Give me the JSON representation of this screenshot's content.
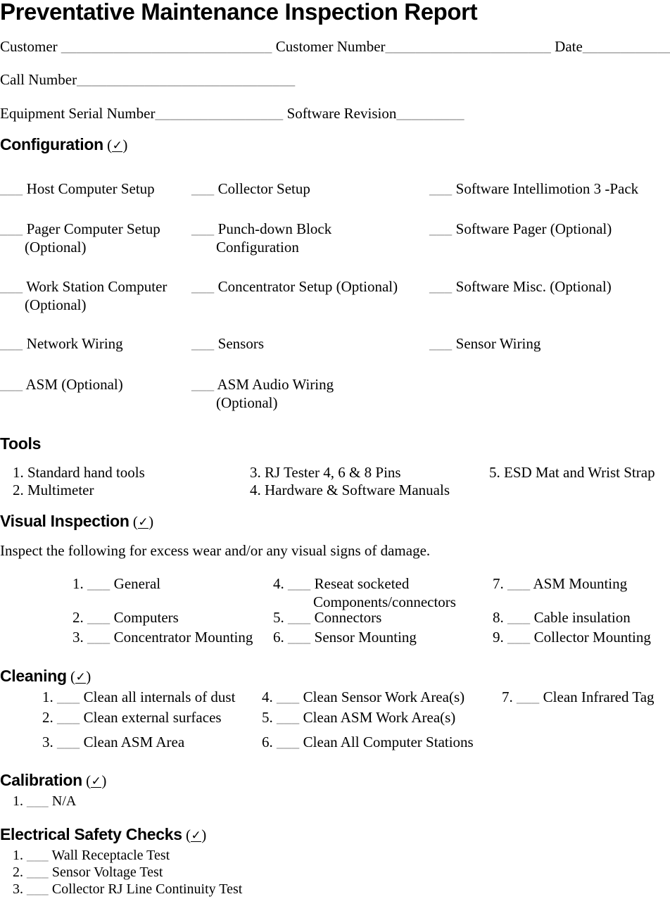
{
  "document": {
    "title": "Preventative Maintenance Inspection Report",
    "check_glyph": "✓"
  },
  "header_fields": {
    "customer_label": "Customer",
    "customer_blank": "____________________________",
    "customer_number_label": "Customer Number",
    "customer_number_blank": "______________________",
    "date_label": "Date",
    "date_blank": "____________",
    "call_number_label": "Call Number",
    "call_number_blank": "_____________________________",
    "equipment_serial_label": "Equipment Serial Number",
    "equipment_serial_blank": "_________________",
    "software_revision_label": "Software Revision",
    "software_revision_blank": "_________"
  },
  "sections": {
    "configuration": {
      "heading": "Configuration",
      "blank": "___",
      "items": [
        {
          "col": 1,
          "row": 1,
          "line1": "Host Computer Setup",
          "line2": ""
        },
        {
          "col": 2,
          "row": 1,
          "line1": "Collector Setup",
          "line2": ""
        },
        {
          "col": 3,
          "row": 1,
          "line1": "Software Intellimotion 3 -Pack",
          "line2": ""
        },
        {
          "col": 1,
          "row": 2,
          "line1": "Pager Computer Setup",
          "line2": "(Optional)"
        },
        {
          "col": 2,
          "row": 2,
          "line1": "Punch-down Block",
          "line2": "Configuration"
        },
        {
          "col": 3,
          "row": 2,
          "line1": "Software Pager (Optional)",
          "line2": ""
        },
        {
          "col": 1,
          "row": 3,
          "line1": "Work Station Computer",
          "line2": "(Optional)"
        },
        {
          "col": 2,
          "row": 3,
          "line1": "Concentrator Setup (Optional)",
          "line2": ""
        },
        {
          "col": 3,
          "row": 3,
          "line1": "Software Misc. (Optional)",
          "line2": ""
        },
        {
          "col": 1,
          "row": 4,
          "line1": "Network Wiring",
          "line2": ""
        },
        {
          "col": 2,
          "row": 4,
          "line1": "Sensors",
          "line2": ""
        },
        {
          "col": 3,
          "row": 4,
          "line1": "Sensor Wiring",
          "line2": ""
        },
        {
          "col": 1,
          "row": 5,
          "line1": "ASM (Optional)",
          "line2": ""
        },
        {
          "col": 2,
          "row": 5,
          "line1": "ASM Audio Wiring",
          "line2": "(Optional)"
        }
      ]
    },
    "tools": {
      "heading": "Tools",
      "items": [
        {
          "col": 1,
          "row": 1,
          "text": "1. Standard hand tools"
        },
        {
          "col": 1,
          "row": 2,
          "text": "2. Multimeter"
        },
        {
          "col": 2,
          "row": 1,
          "text": "3. RJ Tester 4, 6 & 8 Pins"
        },
        {
          "col": 2,
          "row": 2,
          "text": "4. Hardware & Software Manuals"
        },
        {
          "col": 3,
          "row": 1,
          "text": "5. ESD Mat and Wrist Strap"
        }
      ]
    },
    "visual_inspection": {
      "heading": "Visual Inspection",
      "intro": "Inspect the following for excess wear and/or any visual signs of damage.",
      "blank": "___",
      "items": [
        {
          "col": 1,
          "row": 1,
          "number": "1.",
          "line1": "General",
          "line2": ""
        },
        {
          "col": 1,
          "row": 2,
          "number": "2.",
          "line1": "Computers",
          "line2": ""
        },
        {
          "col": 1,
          "row": 3,
          "number": "3.",
          "line1": "Concentrator Mounting",
          "line2": ""
        },
        {
          "col": 2,
          "row": 1,
          "number": "4.",
          "line1": "Reseat socketed",
          "line2": "Components/connectors"
        },
        {
          "col": 2,
          "row": 2,
          "number": "5.",
          "line1": "Connectors",
          "line2": ""
        },
        {
          "col": 2,
          "row": 3,
          "number": "6.",
          "line1": "Sensor Mounting",
          "line2": ""
        },
        {
          "col": 3,
          "row": 1,
          "number": "7.",
          "line1": "ASM Mounting",
          "line2": ""
        },
        {
          "col": 3,
          "row": 2,
          "number": "8.",
          "line1": "Cable insulation",
          "line2": ""
        },
        {
          "col": 3,
          "row": 3,
          "number": "9.",
          "line1": "Collector Mounting",
          "line2": ""
        }
      ]
    },
    "cleaning": {
      "heading": "Cleaning",
      "blank": "___",
      "items": [
        {
          "col": 1,
          "row": 1,
          "number": "1.",
          "text": "Clean all internals of dust"
        },
        {
          "col": 1,
          "row": 2,
          "number": "2.",
          "text": "Clean external surfaces"
        },
        {
          "col": 1,
          "row": 3,
          "number": "3.",
          "text": "Clean ASM Area"
        },
        {
          "col": 2,
          "row": 1,
          "number": "4.",
          "text": "Clean Sensor Work Area(s)"
        },
        {
          "col": 2,
          "row": 2,
          "number": "5.",
          "text": "Clean ASM Work Area(s)"
        },
        {
          "col": 2,
          "row": 3,
          "number": "6.",
          "text": "Clean All Computer Stations"
        },
        {
          "col": 3,
          "row": 1,
          "number": "7.",
          "text": "Clean Infrared Tag"
        }
      ]
    },
    "calibration": {
      "heading": "Calibration",
      "blank": "___",
      "items": [
        {
          "number": "1.",
          "text": "N/A"
        }
      ]
    },
    "electrical_safety_checks": {
      "heading": "Electrical Safety Checks",
      "blank": "___",
      "items": [
        {
          "number": "1.",
          "text": "Wall Receptacle Test"
        },
        {
          "number": "2.",
          "text": "Sensor Voltage Test"
        },
        {
          "number": "3.",
          "text": "Collector RJ Line Continuity Test"
        }
      ]
    }
  }
}
